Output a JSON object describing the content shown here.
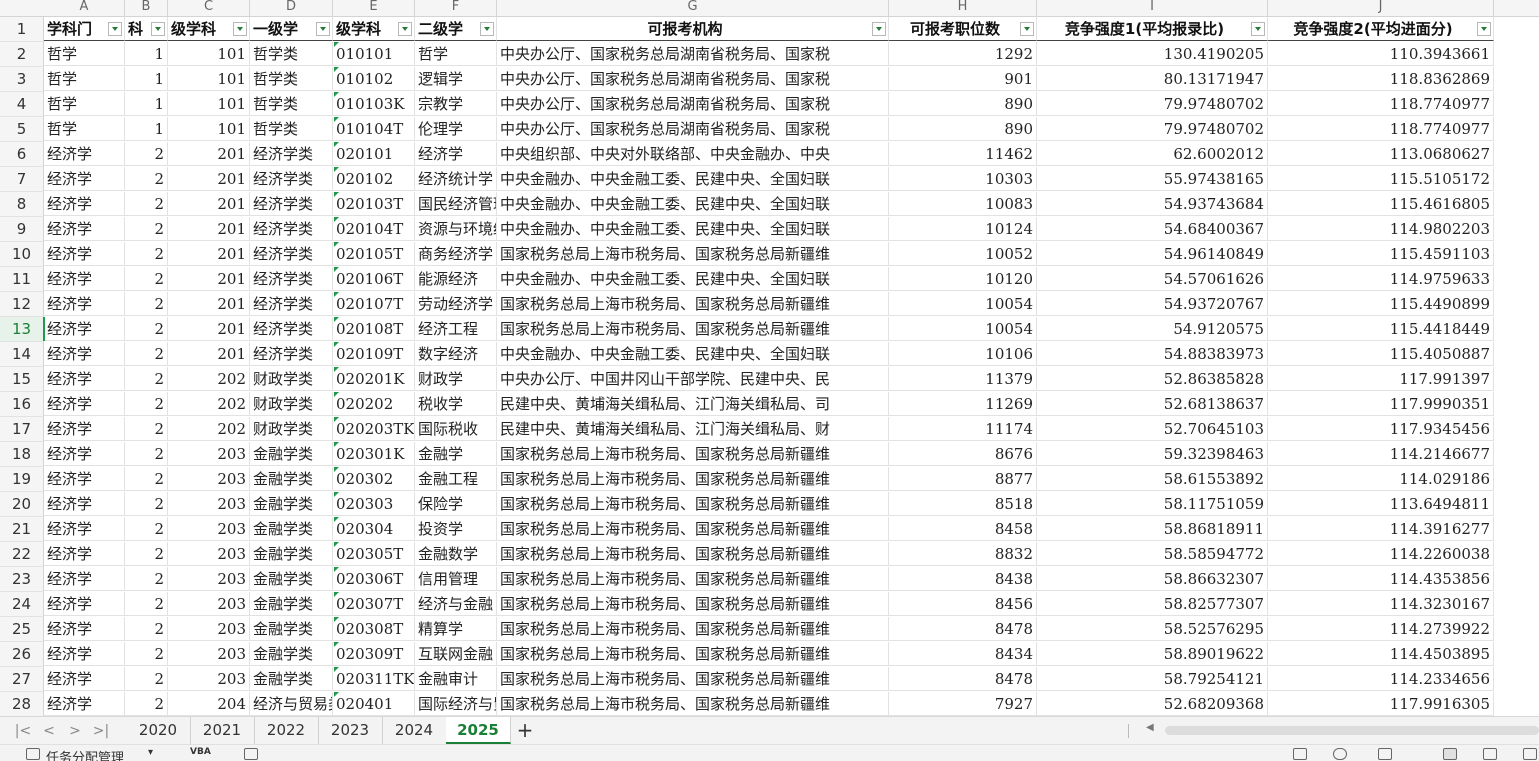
{
  "columns": [
    "A",
    "B",
    "C",
    "D",
    "E",
    "F",
    "G",
    "H",
    "I",
    "J"
  ],
  "headers": [
    "学科门",
    "科",
    "级学科",
    "一级学",
    "级学科",
    "二级学",
    "可报考机构",
    "可报考职位数",
    "竞争强度1(平均报录比)",
    "竞争强度2(平均进面分)"
  ],
  "rows": [
    {
      "n": "2",
      "c": [
        "哲学",
        "1",
        "101",
        "哲学类",
        "010101",
        "哲学",
        "中央办公厅、国家税务总局湖南省税务局、国家税",
        "1292",
        "130.4190205",
        "110.3943661"
      ]
    },
    {
      "n": "3",
      "c": [
        "哲学",
        "1",
        "101",
        "哲学类",
        "010102",
        "逻辑学",
        "中央办公厅、国家税务总局湖南省税务局、国家税",
        "901",
        "80.13171947",
        "118.8362869"
      ]
    },
    {
      "n": "4",
      "c": [
        "哲学",
        "1",
        "101",
        "哲学类",
        "010103K",
        "宗教学",
        "中央办公厅、国家税务总局湖南省税务局、国家税",
        "890",
        "79.97480702",
        "118.7740977"
      ]
    },
    {
      "n": "5",
      "c": [
        "哲学",
        "1",
        "101",
        "哲学类",
        "010104T",
        "伦理学",
        "中央办公厅、国家税务总局湖南省税务局、国家税",
        "890",
        "79.97480702",
        "118.7740977"
      ]
    },
    {
      "n": "6",
      "c": [
        "经济学",
        "2",
        "201",
        "经济学类",
        "020101",
        "经济学",
        "中央组织部、中央对外联络部、中央金融办、中央",
        "11462",
        "62.6002012",
        "113.0680627"
      ]
    },
    {
      "n": "7",
      "c": [
        "经济学",
        "2",
        "201",
        "经济学类",
        "020102",
        "经济统计学",
        "中央金融办、中央金融工委、民建中央、全国妇联",
        "10303",
        "55.97438165",
        "115.5105172"
      ]
    },
    {
      "n": "8",
      "c": [
        "经济学",
        "2",
        "201",
        "经济学类",
        "020103T",
        "国民经济管理",
        "中央金融办、中央金融工委、民建中央、全国妇联",
        "10083",
        "54.93743684",
        "115.4616805"
      ]
    },
    {
      "n": "9",
      "c": [
        "经济学",
        "2",
        "201",
        "经济学类",
        "020104T",
        "资源与环境经济学",
        "中央金融办、中央金融工委、民建中央、全国妇联",
        "10124",
        "54.68400367",
        "114.9802203"
      ]
    },
    {
      "n": "10",
      "c": [
        "经济学",
        "2",
        "201",
        "经济学类",
        "020105T",
        "商务经济学",
        "国家税务总局上海市税务局、国家税务总局新疆维",
        "10052",
        "54.96140849",
        "115.4591103"
      ]
    },
    {
      "n": "11",
      "c": [
        "经济学",
        "2",
        "201",
        "经济学类",
        "020106T",
        "能源经济",
        "中央金融办、中央金融工委、民建中央、全国妇联",
        "10120",
        "54.57061626",
        "114.9759633"
      ]
    },
    {
      "n": "12",
      "c": [
        "经济学",
        "2",
        "201",
        "经济学类",
        "020107T",
        "劳动经济学",
        "国家税务总局上海市税务局、国家税务总局新疆维",
        "10054",
        "54.93720767",
        "115.4490899"
      ]
    },
    {
      "n": "13",
      "c": [
        "经济学",
        "2",
        "201",
        "经济学类",
        "020108T",
        "经济工程",
        "国家税务总局上海市税务局、国家税务总局新疆维",
        "10054",
        "54.9120575",
        "115.4418449"
      ]
    },
    {
      "n": "14",
      "c": [
        "经济学",
        "2",
        "201",
        "经济学类",
        "020109T",
        "数字经济",
        "中央金融办、中央金融工委、民建中央、全国妇联",
        "10106",
        "54.88383973",
        "115.4050887"
      ]
    },
    {
      "n": "15",
      "c": [
        "经济学",
        "2",
        "202",
        "财政学类",
        "020201K",
        "财政学",
        "中央办公厅、中国井冈山干部学院、民建中央、民",
        "11379",
        "52.86385828",
        "117.991397"
      ]
    },
    {
      "n": "16",
      "c": [
        "经济学",
        "2",
        "202",
        "财政学类",
        "020202",
        "税收学",
        "民建中央、黄埔海关缉私局、江门海关缉私局、司",
        "11269",
        "52.68138637",
        "117.9990351"
      ]
    },
    {
      "n": "17",
      "c": [
        "经济学",
        "2",
        "202",
        "财政学类",
        "020203TK",
        "国际税收",
        "民建中央、黄埔海关缉私局、江门海关缉私局、财",
        "11174",
        "52.70645103",
        "117.9345456"
      ]
    },
    {
      "n": "18",
      "c": [
        "经济学",
        "2",
        "203",
        "金融学类",
        "020301K",
        "金融学",
        "国家税务总局上海市税务局、国家税务总局新疆维",
        "8676",
        "59.32398463",
        "114.2146677"
      ]
    },
    {
      "n": "19",
      "c": [
        "经济学",
        "2",
        "203",
        "金融学类",
        "020302",
        "金融工程",
        "国家税务总局上海市税务局、国家税务总局新疆维",
        "8877",
        "58.61553892",
        "114.029186"
      ]
    },
    {
      "n": "20",
      "c": [
        "经济学",
        "2",
        "203",
        "金融学类",
        "020303",
        "保险学",
        "国家税务总局上海市税务局、国家税务总局新疆维",
        "8518",
        "58.11751059",
        "113.6494811"
      ]
    },
    {
      "n": "21",
      "c": [
        "经济学",
        "2",
        "203",
        "金融学类",
        "020304",
        "投资学",
        "国家税务总局上海市税务局、国家税务总局新疆维",
        "8458",
        "58.86818911",
        "114.3916277"
      ]
    },
    {
      "n": "22",
      "c": [
        "经济学",
        "2",
        "203",
        "金融学类",
        "020305T",
        "金融数学",
        "国家税务总局上海市税务局、国家税务总局新疆维",
        "8832",
        "58.58594772",
        "114.2260038"
      ]
    },
    {
      "n": "23",
      "c": [
        "经济学",
        "2",
        "203",
        "金融学类",
        "020306T",
        "信用管理",
        "国家税务总局上海市税务局、国家税务总局新疆维",
        "8438",
        "58.86632307",
        "114.4353856"
      ]
    },
    {
      "n": "24",
      "c": [
        "经济学",
        "2",
        "203",
        "金融学类",
        "020307T",
        "经济与金融",
        "国家税务总局上海市税务局、国家税务总局新疆维",
        "8456",
        "58.82577307",
        "114.3230167"
      ]
    },
    {
      "n": "25",
      "c": [
        "经济学",
        "2",
        "203",
        "金融学类",
        "020308T",
        "精算学",
        "国家税务总局上海市税务局、国家税务总局新疆维",
        "8478",
        "58.52576295",
        "114.2739922"
      ]
    },
    {
      "n": "26",
      "c": [
        "经济学",
        "2",
        "203",
        "金融学类",
        "020309T",
        "互联网金融",
        "国家税务总局上海市税务局、国家税务总局新疆维",
        "8434",
        "58.89019622",
        "114.4503895"
      ]
    },
    {
      "n": "27",
      "c": [
        "经济学",
        "2",
        "203",
        "金融学类",
        "020311TK",
        "金融审计",
        "国家税务总局上海市税务局、国家税务总局新疆维",
        "8478",
        "58.79254121",
        "114.2334656"
      ]
    },
    {
      "n": "28",
      "c": [
        "经济学",
        "2",
        "204",
        "经济与贸易类",
        "020401",
        "国际经济与贸易",
        "国家税务总局上海市税务局、国家税务总局新疆维",
        "7927",
        "52.68209368",
        "117.9916305"
      ]
    }
  ],
  "sheet_tabs": [
    "2020",
    "2021",
    "2022",
    "2023",
    "2024",
    "2025"
  ],
  "active_tab": "2025",
  "status_bar": {
    "task_pane": "任务分配管理",
    "dropdown": "▾",
    "vba_label": "VBA"
  },
  "colors": {
    "accent": "#1a7f37",
    "filter_arrow": "#2a7a3a",
    "comment_marker": "#1f9a4a"
  },
  "icons": [
    "nav-first-icon",
    "nav-prev-icon",
    "nav-next-icon",
    "nav-last-icon",
    "add-sheet-icon",
    "filter-dropdown-icon"
  ]
}
